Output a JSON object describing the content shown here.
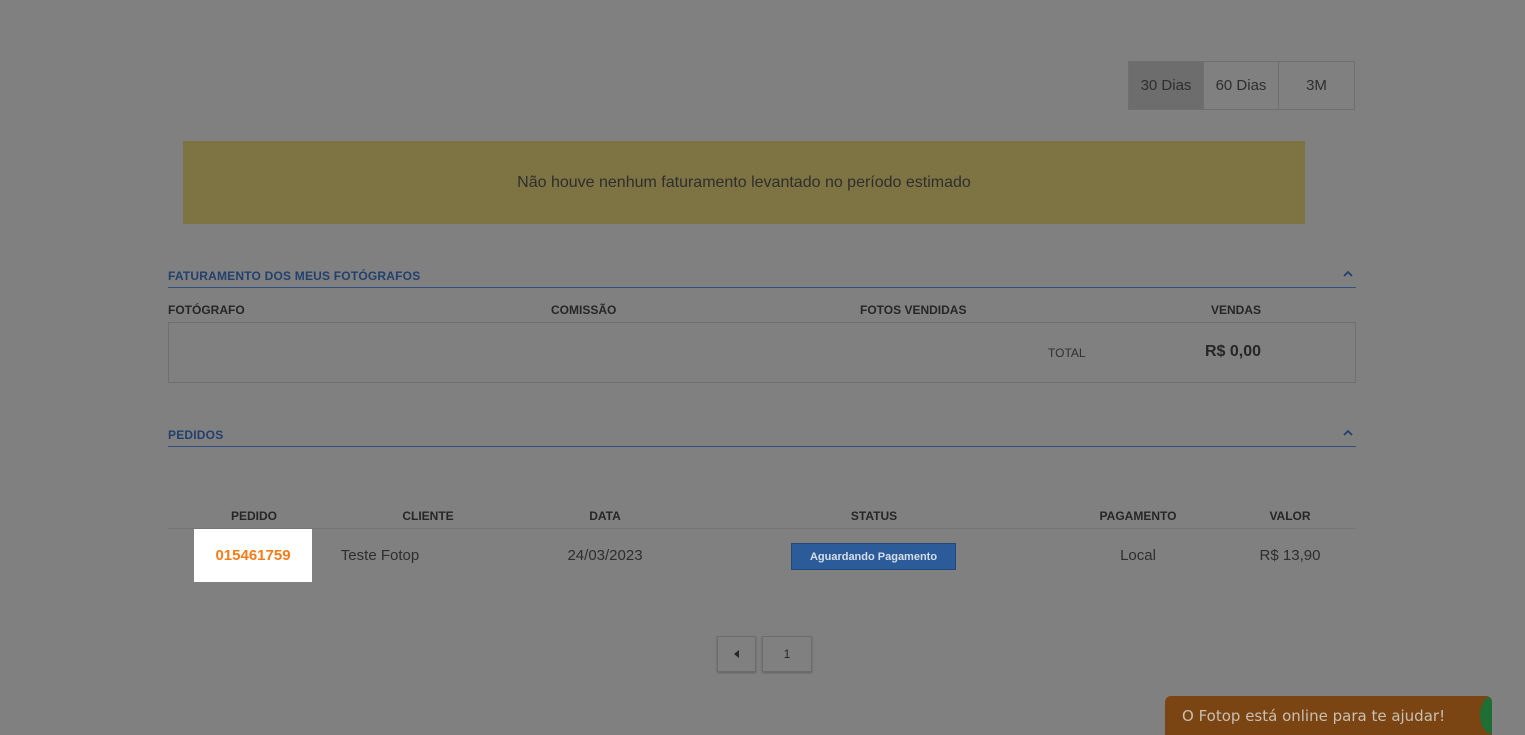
{
  "period_options": [
    {
      "label": "30 Dias",
      "active": true
    },
    {
      "label": "60 Dias",
      "active": false
    },
    {
      "label": "3M",
      "active": false
    }
  ],
  "alert": {
    "message": "Não houve nenhum faturamento levantado no período estimado"
  },
  "photographers": {
    "title": "FATURAMENTO DOS MEUS FOTÓGRAFOS",
    "columns": [
      "FOTÓGRAFO",
      "COMISSÃO",
      "FOTOS VENDIDAS",
      "VENDAS"
    ],
    "total_label": "TOTAL",
    "total_value": "R$ 0,00"
  },
  "orders": {
    "title": "PEDIDOS",
    "columns": [
      "PEDIDO",
      "CLIENTE",
      "DATA",
      "STATUS",
      "PAGAMENTO",
      "VALOR"
    ],
    "rows": [
      {
        "pedido": "015461759",
        "cliente": "Teste Fotop",
        "data": "24/03/2023",
        "status": "Aguardando Pagamento",
        "pagamento": "Local",
        "valor": "R$ 13,90"
      }
    ]
  },
  "pagination": {
    "prev_icon": "caret-left-icon",
    "current_page": "1"
  },
  "chat": {
    "text": "O Fotop está online para te ajudar!"
  },
  "colors": {
    "accent_orange": "#f27d1a",
    "status_blue": "#2b5c99",
    "header_blue": "#22406e"
  }
}
